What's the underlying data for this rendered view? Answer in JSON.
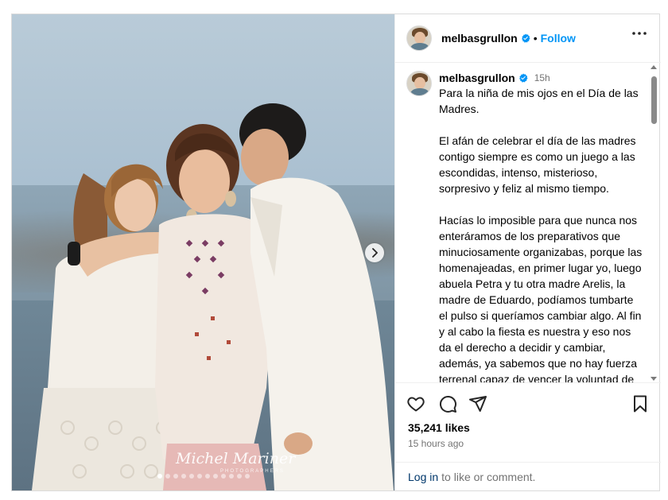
{
  "header": {
    "username": "melbasgrullon",
    "separator": "•",
    "follow_label": "Follow"
  },
  "carousel": {
    "slide_count": 12,
    "active_index": 0
  },
  "photo": {
    "watermark": "Michel Mariner",
    "watermark_sub": "PHOTOGRAPHERS"
  },
  "caption": {
    "username": "melbasgrullon",
    "time": "15h",
    "text": "Para la niña de mis ojos en el Día de las Madres.\n\nEl afán de celebrar el día de las madres contigo siempre es como un juego a las escondidas, intenso, misterioso, sorpresivo y feliz al mismo tiempo.\n\nHacías lo imposible para que nunca nos enteráramos de los preparativos que minuciosamente organizabas, porque las homenajeadas, en primer lugar yo, luego abuela Petra y tu otra madre Arelis, la madre de Eduardo, podíamos tumbarte el pulso si queríamos cambiar algo. Al fin y al cabo la fiesta es nuestra y eso nos da el derecho a decidir y cambiar, además, ya sabemos que no hay fuerza terrenal capaz de vencer la voluntad de una madre."
  },
  "stats": {
    "likes": "35,241 likes",
    "posted": "15 hours ago"
  },
  "footer": {
    "login_link": "Log in",
    "login_text": "to like or comment."
  },
  "colors": {
    "accent": "#0095f6",
    "verified": "#0095f6",
    "muted": "#737373"
  },
  "icons": {
    "more": "more-horizontal-icon",
    "like": "heart-icon",
    "comment": "comment-icon",
    "share": "send-icon",
    "save": "bookmark-icon",
    "next": "chevron-right-icon"
  }
}
